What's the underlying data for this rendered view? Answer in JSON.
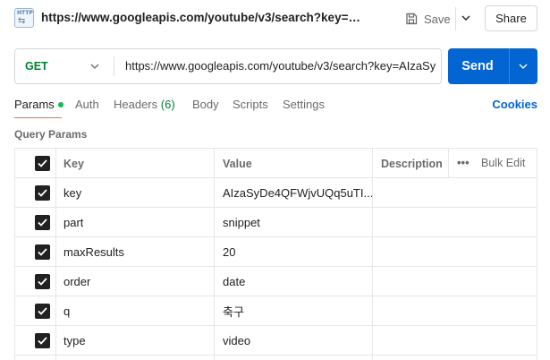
{
  "titlebar": {
    "url": "https://www.googleapis.com/youtube/v3/search?key=AIzaS...",
    "save_label": "Save",
    "share_label": "Share"
  },
  "request": {
    "method": "GET",
    "url": "https://www.googleapis.com/youtube/v3/search?key=AIzaSy",
    "send_label": "Send"
  },
  "tabs": [
    {
      "label": "Params"
    },
    {
      "label": "Auth"
    },
    {
      "label": "Headers",
      "count": "(6)"
    },
    {
      "label": "Body"
    },
    {
      "label": "Scripts"
    },
    {
      "label": "Settings"
    }
  ],
  "cookies_label": "Cookies",
  "query_params": {
    "title": "Query Params",
    "headers": {
      "key": "Key",
      "value": "Value",
      "description": "Description",
      "more": "•••",
      "bulk_edit": "Bulk Edit"
    },
    "rows": [
      {
        "key": "key",
        "value": "AIzaSyDe4QFWjvUQq5uTI...",
        "description": ""
      },
      {
        "key": "part",
        "value": "snippet",
        "description": ""
      },
      {
        "key": "maxResults",
        "value": "20",
        "description": ""
      },
      {
        "key": "order",
        "value": "date",
        "description": ""
      },
      {
        "key": "q",
        "value": "축구",
        "description": ""
      },
      {
        "key": "type",
        "value": "video",
        "description": ""
      }
    ]
  },
  "colors": {
    "accent": "#0265d2",
    "method": "#007f31",
    "tab_underline": "#ff6c37",
    "dot": "#0cbb52"
  }
}
